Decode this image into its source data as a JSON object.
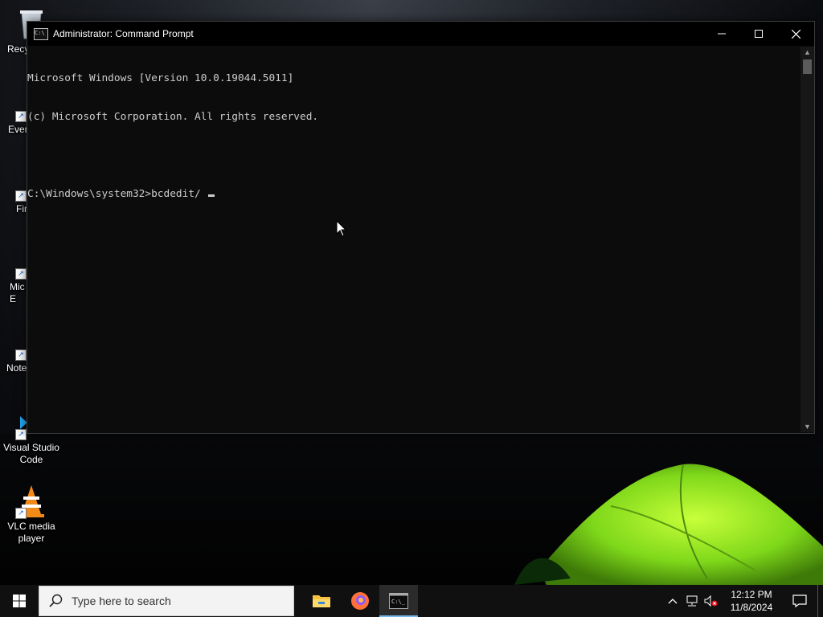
{
  "desktop": {
    "icons": [
      {
        "label": "Recy"
      },
      {
        "label": "Ever"
      },
      {
        "label": "Fir"
      },
      {
        "label": "Mic\nE"
      },
      {
        "label": "Note"
      },
      {
        "label": "Visual Studio Code"
      },
      {
        "label": "VLC media player"
      }
    ]
  },
  "window": {
    "title": "Administrator: Command Prompt",
    "app_icon_text": "C:\\",
    "console_lines": [
      "Microsoft Windows [Version 10.0.19044.5011]",
      "(c) Microsoft Corporation. All rights reserved.",
      "",
      "C:\\Windows\\system32>bcdedit/ "
    ]
  },
  "taskbar": {
    "search_placeholder": "Type here to search",
    "apps": [
      {
        "icon": "file-explorer-icon",
        "active": false
      },
      {
        "icon": "firefox-icon",
        "active": false
      },
      {
        "icon": "command-prompt-icon",
        "active": true
      }
    ],
    "clock_time": "12:12 PM",
    "clock_date": "11/8/2024"
  },
  "colors": {
    "console_bg": "#0c0c0c",
    "console_fg": "#cccccc",
    "taskbar_bg": "#101010",
    "accent": "#76b9ed"
  }
}
